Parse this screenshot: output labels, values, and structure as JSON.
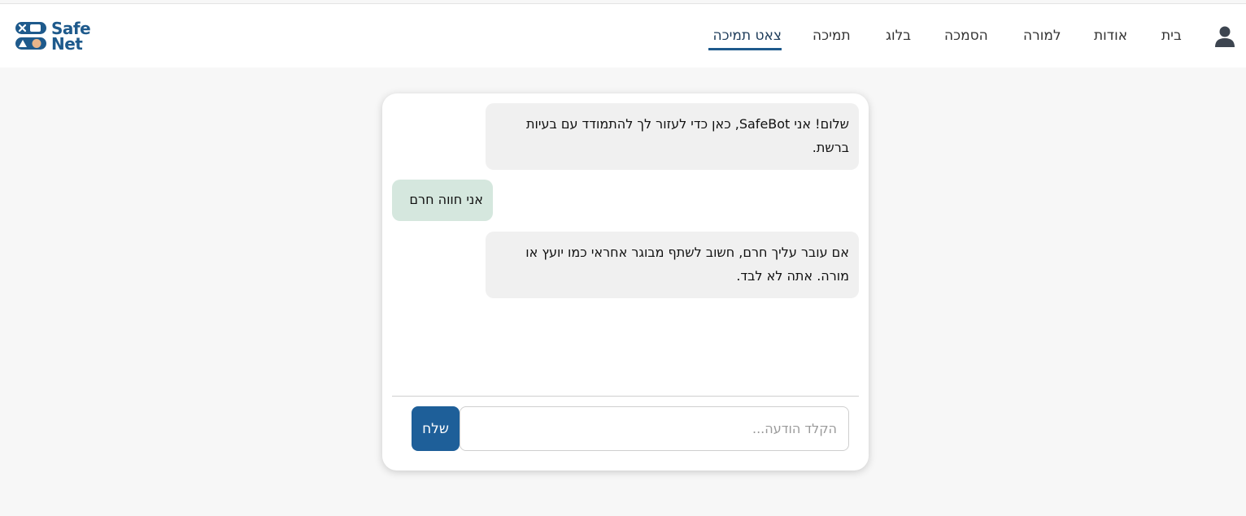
{
  "brand": {
    "line1": "Safe",
    "line2": "Net",
    "color": "#1e5a8c",
    "accent": "#e8b48a"
  },
  "nav": {
    "items": [
      {
        "id": "home",
        "label": "בית"
      },
      {
        "id": "about",
        "label": "אודות"
      },
      {
        "id": "teacher",
        "label": "למורה"
      },
      {
        "id": "consent",
        "label": "הסמכה"
      },
      {
        "id": "blog",
        "label": "בלוג"
      },
      {
        "id": "support",
        "label": "תמיכה"
      },
      {
        "id": "chat",
        "label": "צאט תמיכה",
        "active": true
      }
    ],
    "user_icon": "user-icon"
  },
  "chat": {
    "messages": [
      {
        "sender": "bot",
        "text": "שלום! אני SafeBot, כאן כדי לעזור לך להתמודד עם בעיות ברשת."
      },
      {
        "sender": "user",
        "text": "אני חווה חרם"
      },
      {
        "sender": "bot",
        "text": "אם עובר עליך חרם, חשוב לשתף מבוגר אחראי כמו יועץ או מורה. אתה לא לבד."
      }
    ],
    "input": {
      "value": "",
      "placeholder": "הקלד הודעה..."
    },
    "send_label": "שלח"
  },
  "colors": {
    "bot_bubble": "#f0f0f0",
    "user_bubble": "#d5e7de",
    "send_button": "#1e5f99",
    "active_underline": "#1e5a8c"
  }
}
